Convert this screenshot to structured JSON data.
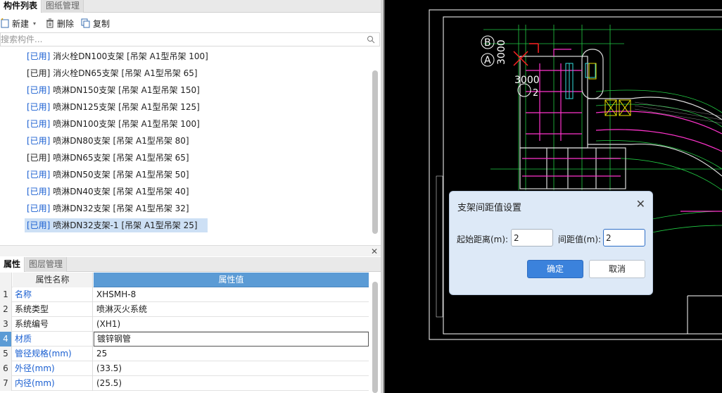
{
  "top_tabs": {
    "component_list": "构件列表",
    "drawing_manage": "图纸管理"
  },
  "toolbar": {
    "new_label": "新建",
    "delete_label": "删除",
    "copy_label": "复制"
  },
  "search": {
    "placeholder": "搜索构件..."
  },
  "components": [
    {
      "used": "[已用]",
      "used_blue": true,
      "name": " 消火栓DN100支架 [吊架 A1型吊架 100]"
    },
    {
      "used": "[已用]",
      "used_blue": false,
      "name": " 消火栓DN65支架 [吊架 A1型吊架 65]"
    },
    {
      "used": "[已用]",
      "used_blue": true,
      "name": " 喷淋DN150支架 [吊架 A1型吊架 150]"
    },
    {
      "used": "[已用]",
      "used_blue": true,
      "name": " 喷淋DN125支架 [吊架 A1型吊架 125]"
    },
    {
      "used": "[已用]",
      "used_blue": true,
      "name": " 喷淋DN100支架 [吊架 A1型吊架 100]"
    },
    {
      "used": "[已用]",
      "used_blue": true,
      "name": " 喷淋DN80支架 [吊架 A1型吊架 80]"
    },
    {
      "used": "[已用]",
      "used_blue": false,
      "name": " 喷淋DN65支架 [吊架 A1型吊架 65]"
    },
    {
      "used": "[已用]",
      "used_blue": true,
      "name": " 喷淋DN50支架 [吊架 A1型吊架 50]"
    },
    {
      "used": "[已用]",
      "used_blue": true,
      "name": " 喷淋DN40支架 [吊架 A1型吊架 40]"
    },
    {
      "used": "[已用]",
      "used_blue": true,
      "name": " 喷淋DN32支架 [吊架 A1型吊架 32]"
    },
    {
      "used": "[已用]",
      "used_blue": true,
      "name": " 喷淋DN32支架-1 [吊架 A1型吊架 25]",
      "selected": true
    }
  ],
  "prop_tabs": {
    "properties": "属性",
    "layer_manage": "图层管理"
  },
  "prop_grid": {
    "col_name": "属性名称",
    "col_value": "属性值",
    "rows": [
      {
        "num": "1",
        "name": "名称",
        "name_blue": true,
        "value": "XHSMH-8"
      },
      {
        "num": "2",
        "name": "系统类型",
        "name_blue": false,
        "value": "喷淋灭火系统"
      },
      {
        "num": "3",
        "name": "系统编号",
        "name_blue": false,
        "value": "(XH1)"
      },
      {
        "num": "4",
        "name": "材质",
        "name_blue": true,
        "value": "镀锌钢管",
        "active": true
      },
      {
        "num": "5",
        "name": "管径规格(mm)",
        "name_blue": true,
        "value": "25"
      },
      {
        "num": "6",
        "name": "外径(mm)",
        "name_blue": true,
        "value": "(33.5)"
      },
      {
        "num": "7",
        "name": "内径(mm)",
        "name_blue": true,
        "value": "(25.5)"
      }
    ]
  },
  "cad": {
    "labels": {
      "b": "B",
      "a": "A",
      "dim_vertical": "3000",
      "dim_horizontal": "3000",
      "grid_2": "2"
    },
    "colors": {
      "background": "#000000",
      "frame": "#ffffff",
      "green": "#22cc44",
      "magenta": "#ff33cc",
      "red": "#ff2222",
      "yellow": "#e8e000",
      "cyan": "#33dddd"
    }
  },
  "dialog": {
    "title": "支架间距值设置",
    "start_label": "起始距离(m):",
    "start_value": "2",
    "spacing_label": "间距值(m):",
    "spacing_value": "2",
    "ok_label": "确定",
    "cancel_label": "取消"
  }
}
